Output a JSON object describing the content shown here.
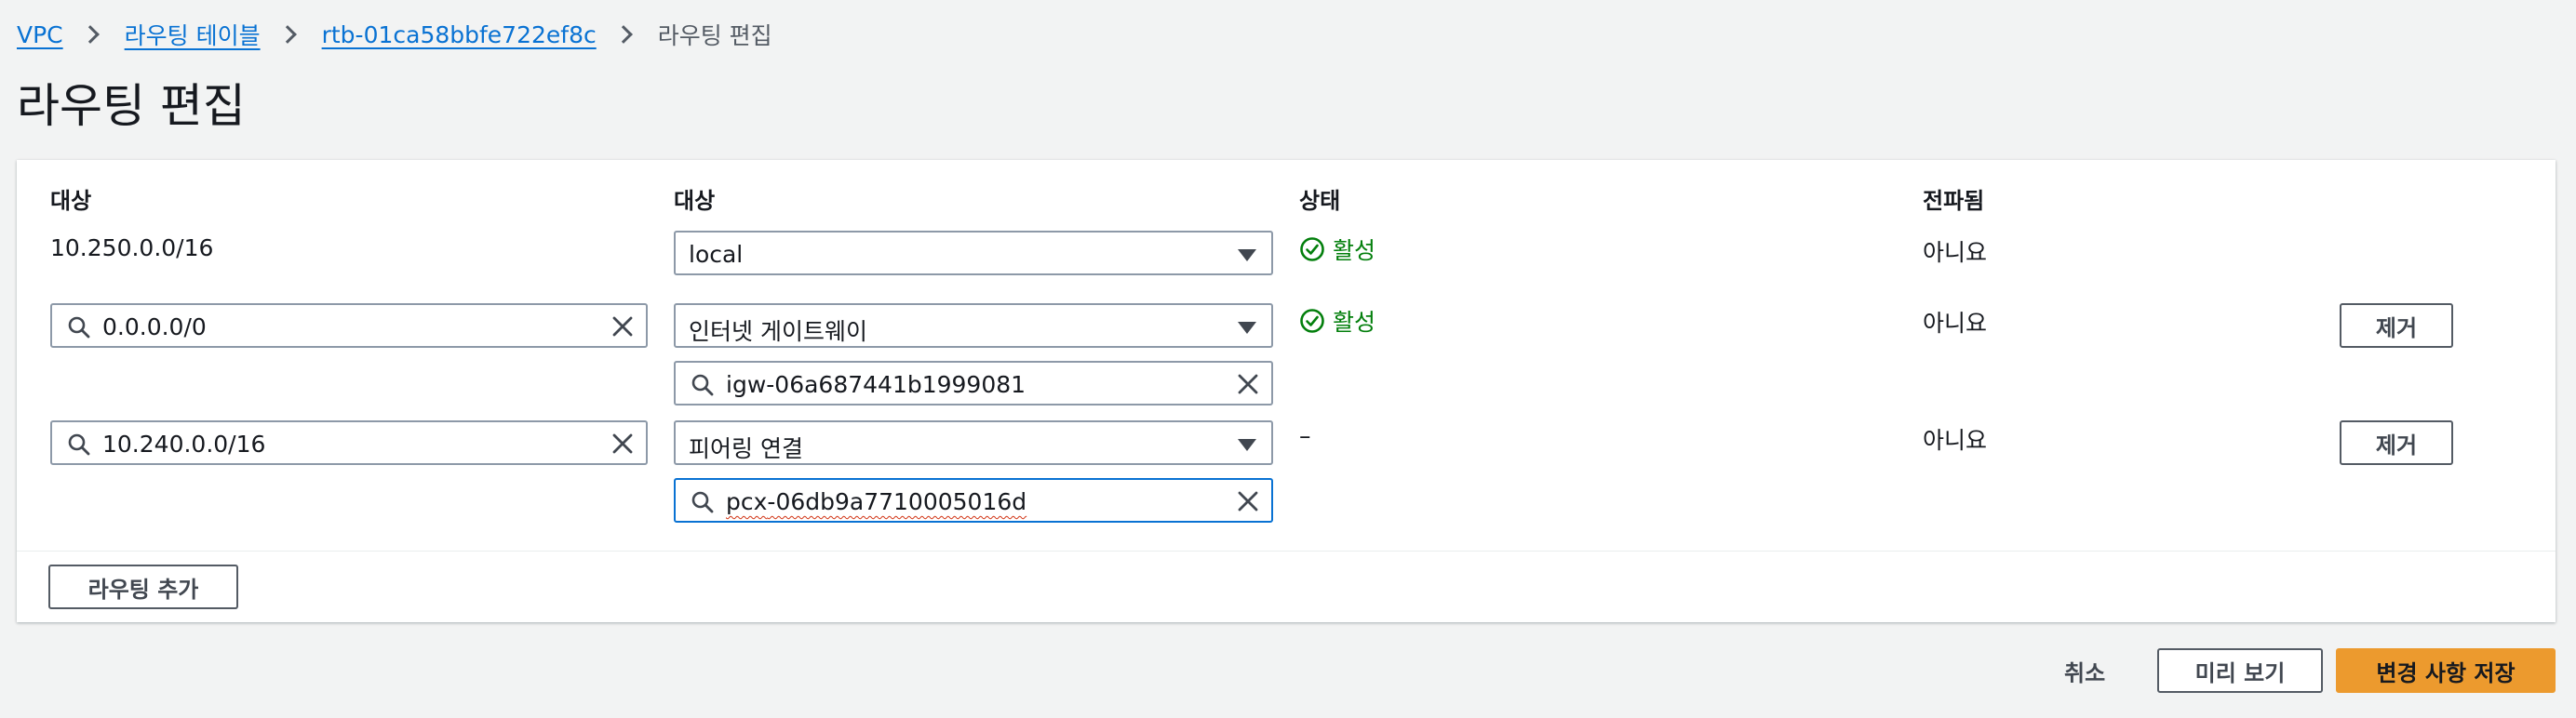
{
  "breadcrumb": {
    "items": [
      "VPC",
      "라우팅 테이블",
      "rtb-01ca58bbfe722ef8c"
    ],
    "current": "라우팅 편집"
  },
  "page": {
    "title": "라우팅 편집"
  },
  "table": {
    "headers": {
      "destination": "대상",
      "target": "대상",
      "status": "상태",
      "propagated": "전파됨"
    },
    "rows": [
      {
        "destination": "10.250.0.0/16",
        "target": "local",
        "status": "활성",
        "propagated": "아니요"
      },
      {
        "destination": "0.0.0.0/0",
        "target": "인터넷 게이트웨이",
        "target_id": "igw-06a687441b1999081",
        "status": "활성",
        "propagated": "아니요",
        "remove_label": "제거"
      },
      {
        "destination": "10.240.0.0/16",
        "target": "피어링 연결",
        "target_id_prefix": "pcx",
        "target_id_rest": "-06db9a7710005016d",
        "status": "–",
        "propagated": "아니요",
        "remove_label": "제거"
      }
    ]
  },
  "add_route_label": "라우팅 추가",
  "footer": {
    "cancel": "취소",
    "preview": "미리 보기",
    "save": "변경 사항 저장"
  },
  "colors": {
    "link": "#0972d3",
    "success": "#037f0c",
    "primary": "#ec9a2e",
    "border": "#8d99a8",
    "focus": "#0972d3"
  },
  "icons": [
    "chevron-right-icon",
    "search-icon",
    "close-icon",
    "caret-down-icon",
    "check-circle-icon"
  ]
}
